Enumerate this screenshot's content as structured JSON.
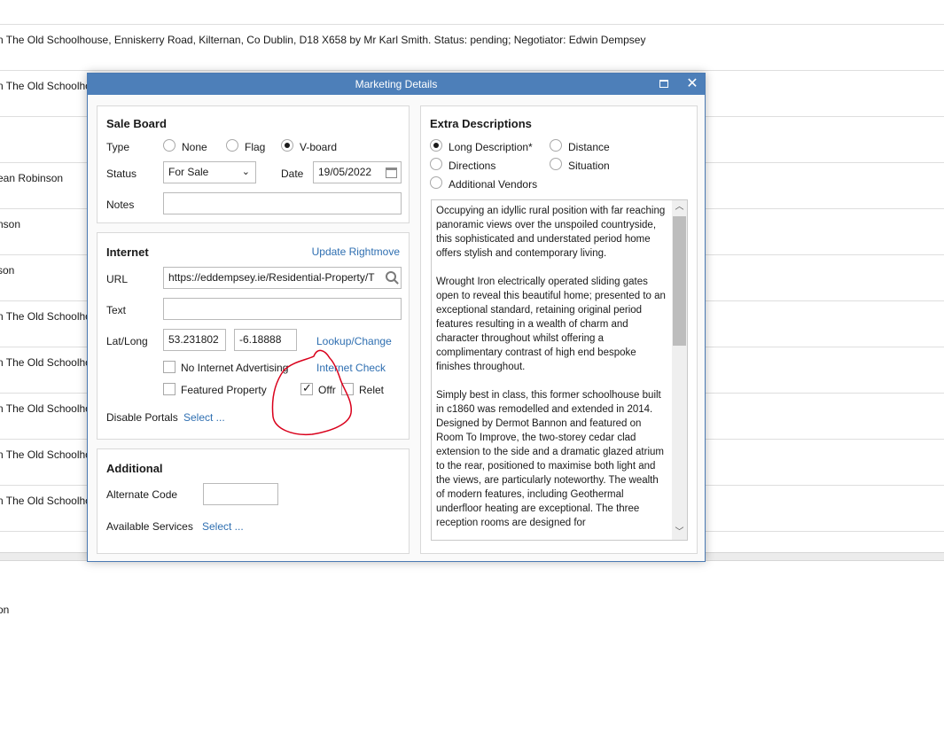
{
  "background": {
    "rows": [
      "n The Old Schoolhouse, Enniskerry Road, Kilternan, Co Dublin, D18 X658 by Mr Karl Smith. Status: pending; Negotiator: Edwin Dempsey",
      "n The Old Schoolho",
      "",
      "ean Robinson",
      "nson",
      "son",
      "n The Old Schoolho",
      "n The Old Schoolho",
      "n The Old Schoolho",
      "n The Old Schoolho",
      "n The Old Schoolho"
    ],
    "last_row": "on"
  },
  "dialog": {
    "title": "Marketing Details",
    "close_icon": "close-icon",
    "maximize_icon": "maximize-icon"
  },
  "sale_board": {
    "heading": "Sale Board",
    "type_label": "Type",
    "type_options": [
      "None",
      "Flag",
      "V-board"
    ],
    "type_selected": "V-board",
    "status_label": "Status",
    "status_value": "For Sale",
    "date_label": "Date",
    "date_value": "19/05/2022",
    "notes_label": "Notes",
    "notes_value": ""
  },
  "internet": {
    "heading": "Internet",
    "update_link": "Update Rightmove",
    "url_label": "URL",
    "url_value": "https://eddempsey.ie/Residential-Property/T",
    "text_label": "Text",
    "text_value": "",
    "latlong_label": "Lat/Long",
    "lat_value": "53.231802",
    "long_value": "-6.18888",
    "lookup_link": "Lookup/Change",
    "no_advertising_label": "No Internet Advertising",
    "no_advertising_checked": false,
    "internet_check_link": "Internet Check",
    "featured_label": "Featured Property",
    "featured_checked": false,
    "offr_label": "Offr",
    "offr_checked": true,
    "relet_label": "Relet",
    "relet_checked": false,
    "disable_portals_label": "Disable Portals",
    "disable_portals_link": "Select ..."
  },
  "additional": {
    "heading": "Additional",
    "alt_code_label": "Alternate Code",
    "alt_code_value": "",
    "services_label": "Available Services",
    "services_link": "Select ..."
  },
  "extra_descriptions": {
    "heading": "Extra Descriptions",
    "options": [
      "Long Description*",
      "Distance",
      "Directions",
      "Situation",
      "Additional Vendors"
    ],
    "selected": "Long Description*",
    "text": "Occupying an idyllic rural position with far reaching panoramic views over the unspoiled countryside, this sophisticated and understated period home offers stylish and contemporary living.\n\nWrought Iron electrically operated sliding gates open to reveal this beautiful home; presented to an exceptional standard, retaining original period features resulting in a wealth of charm and character throughout whilst offering a complimentary contrast of high end bespoke finishes throughout.\n\nSimply best in class, this former schoolhouse built in c1860 was remodelled and extended in 2014. Designed by Dermot Bannon and featured on Room To Improve, the two-storey cedar clad extension to the side and a dramatic glazed atrium to the rear, positioned to maximise both light and the views, are particularly noteworthy. The wealth of modern features, including Geothermal underfloor heating are exceptional. The three reception rooms are designed for"
  },
  "annotation_color": "#d9001b"
}
